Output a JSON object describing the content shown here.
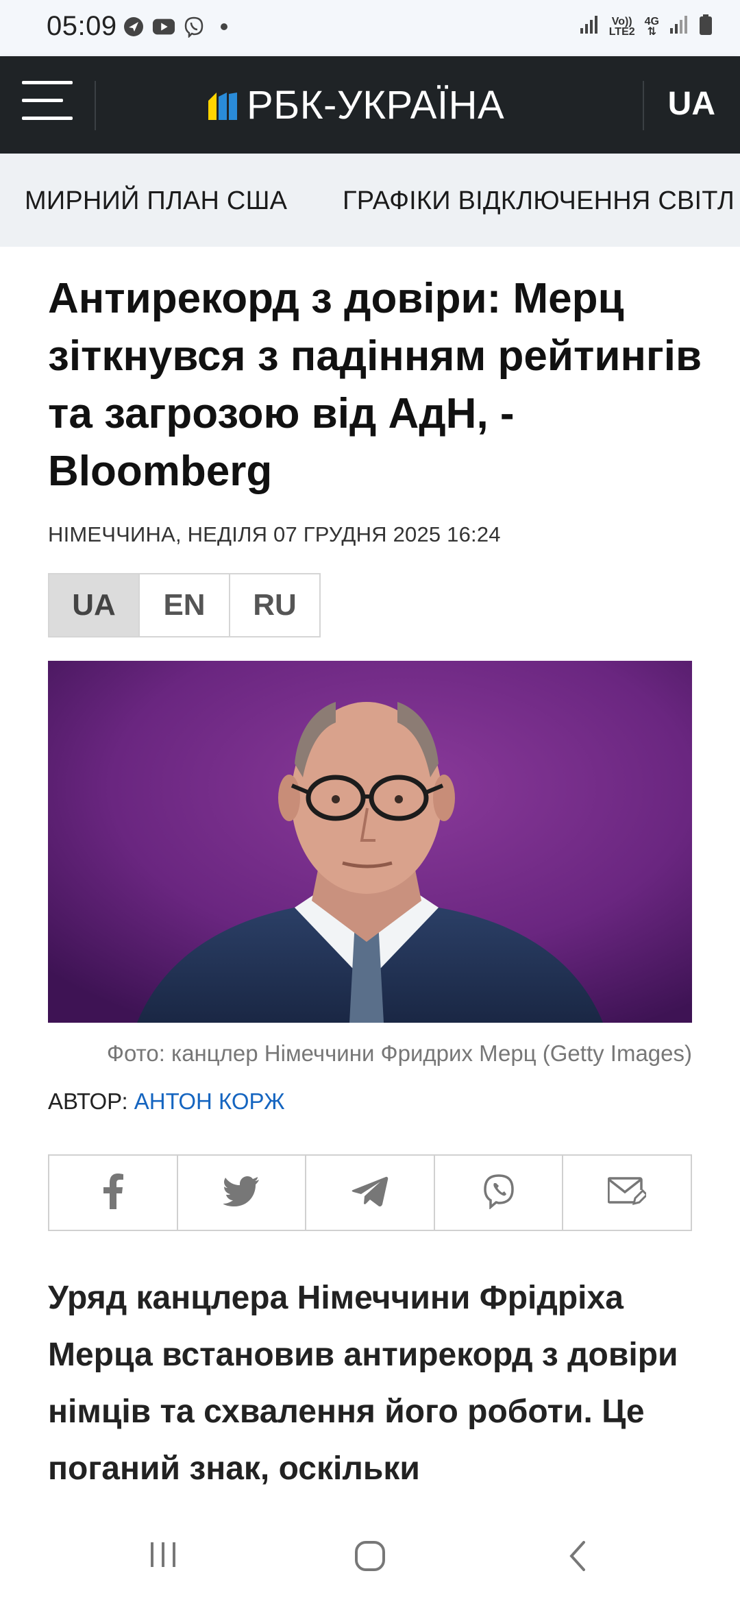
{
  "status_bar": {
    "time": "05:09",
    "network_top": "Vo))",
    "network_bottom": "LTE2",
    "gen": "4G"
  },
  "header": {
    "site_name": "РБК-УКРАЇНА",
    "language": "UA",
    "brand_colors": {
      "yellow": "#ffd400",
      "blue": "#2a8bd8"
    }
  },
  "nav": {
    "items": [
      {
        "label": "МИРНИЙ ПЛАН США"
      },
      {
        "label": "ГРАФІКИ ВІДКЛЮЧЕННЯ СВІТЛ"
      }
    ]
  },
  "article": {
    "title": "Антирекорд з довіри: Мерц зіткнувся з падінням рейтингів та загрозою від АдН, - Bloomberg",
    "meta": "НІМЕЧЧИНА, НЕДІЛЯ 07 ГРУДНЯ 2025 16:24",
    "languages": [
      "UA",
      "EN",
      "RU"
    ],
    "active_language": "UA",
    "photo_caption": "Фото: канцлер Німеччини Фридрих Мерц (Getty Images)",
    "author_label": "АВТОР:",
    "author_name": "АНТОН КОРЖ",
    "share_icons": [
      "facebook-icon",
      "twitter-icon",
      "telegram-icon",
      "viber-icon",
      "email-icon"
    ],
    "lead": "Уряд канцлера Німеччини Фрідріха Мерца встановив антирекорд з довіри німців та схвалення його роботи. Це поганий знак, оскільки"
  },
  "system_nav": {
    "icons": [
      "recents-icon",
      "home-icon",
      "back-icon"
    ]
  }
}
